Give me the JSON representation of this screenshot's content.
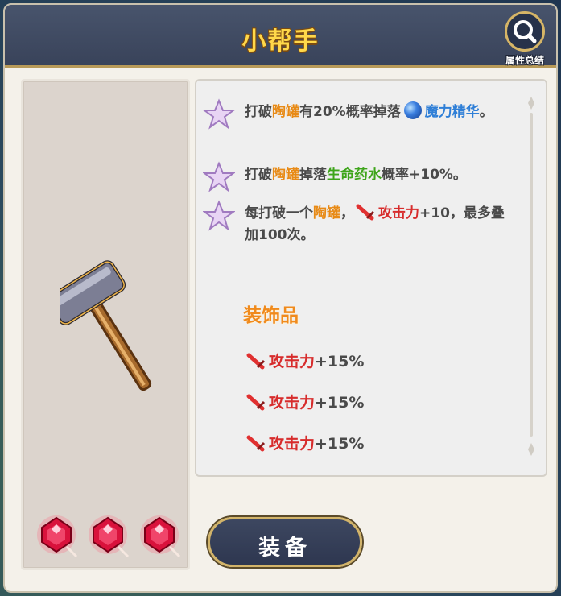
{
  "header": {
    "title": "小帮手",
    "summary_label": "属性总结",
    "summary_icon": "magnifier-icon"
  },
  "item": {
    "image": "hammer-icon",
    "gems": [
      "ruby-gem-icon",
      "ruby-gem-icon",
      "ruby-gem-icon"
    ]
  },
  "effects": [
    {
      "prefix": "打破",
      "hl1": "陶罐",
      "mid": "有20%概率掉落",
      "hl2": "魔力精华",
      "suffix": "。"
    },
    {
      "prefix": "打破",
      "hl1": "陶罐",
      "mid": "掉落",
      "hl2": "生命药水",
      "suffix": "概率+10%。"
    },
    {
      "prefix": "每打破一个",
      "hl1": "陶罐",
      "mid": "，",
      "hl2": "攻击力",
      "suffix": "+10，最多叠加100次。"
    }
  ],
  "decoration": {
    "title": "装饰品",
    "stats": [
      {
        "name": "攻击力",
        "value": "+15%"
      },
      {
        "name": "攻击力",
        "value": "+15%"
      },
      {
        "name": "攻击力",
        "value": "+15%"
      }
    ]
  },
  "equip_button": "装备",
  "colors": {
    "highlight_orange": "#e88a15",
    "highlight_green": "#3ea51a",
    "highlight_blue": "#2f7fd7",
    "attack_red": "#d72c2c",
    "title_gold": "#ffd84a"
  }
}
